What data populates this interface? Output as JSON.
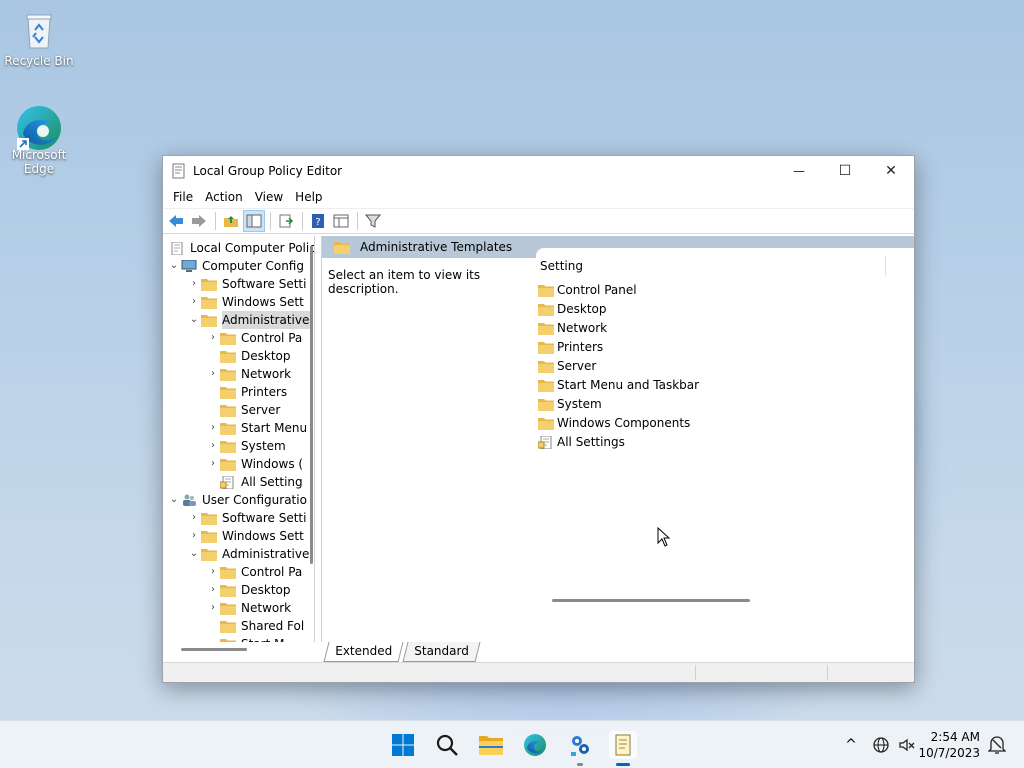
{
  "desktop": {
    "icons": [
      {
        "label": "Recycle Bin"
      },
      {
        "label_line1": "Microsoft",
        "label_line2": "Edge"
      }
    ]
  },
  "window": {
    "title": "Local Group Policy Editor",
    "controls": {
      "minimize": "—",
      "maximize": "☐",
      "close": "✕"
    },
    "menu": [
      "File",
      "Action",
      "View",
      "Help"
    ],
    "tree": [
      {
        "label": "Local Computer Polic",
        "level": 0,
        "chevron": "",
        "icon": "computer-policy-icon"
      },
      {
        "label": "Computer Config",
        "level": 1,
        "chevron": "⌄",
        "icon": "computer-icon"
      },
      {
        "label": "Software Setti",
        "level": 2,
        "chevron": "›",
        "icon": "folder-icon"
      },
      {
        "label": "Windows Sett",
        "level": 2,
        "chevron": "›",
        "icon": "folder-icon"
      },
      {
        "label": "Administrative",
        "level": 2,
        "chevron": "⌄",
        "icon": "folder-icon",
        "selected": true
      },
      {
        "label": "Control Pa",
        "level": 3,
        "chevron": "›",
        "icon": "folder-icon"
      },
      {
        "label": "Desktop",
        "level": 3,
        "chevron": "",
        "icon": "folder-icon"
      },
      {
        "label": "Network",
        "level": 3,
        "chevron": "›",
        "icon": "folder-icon"
      },
      {
        "label": "Printers",
        "level": 3,
        "chevron": "",
        "icon": "folder-icon"
      },
      {
        "label": "Server",
        "level": 3,
        "chevron": "",
        "icon": "folder-icon"
      },
      {
        "label": "Start Menu",
        "level": 3,
        "chevron": "›",
        "icon": "folder-icon"
      },
      {
        "label": "System",
        "level": 3,
        "chevron": "›",
        "icon": "folder-icon"
      },
      {
        "label": "Windows (",
        "level": 3,
        "chevron": "›",
        "icon": "folder-icon"
      },
      {
        "label": "All Setting",
        "level": 3,
        "chevron": "",
        "icon": "settings-page-icon"
      },
      {
        "label": "User Configuratio",
        "level": 1,
        "chevron": "⌄",
        "icon": "users-icon"
      },
      {
        "label": "Software Setti",
        "level": 2,
        "chevron": "›",
        "icon": "folder-icon"
      },
      {
        "label": "Windows Sett",
        "level": 2,
        "chevron": "›",
        "icon": "folder-icon"
      },
      {
        "label": "Administrative",
        "level": 2,
        "chevron": "⌄",
        "icon": "folder-icon"
      },
      {
        "label": "Control Pa",
        "level": 3,
        "chevron": "›",
        "icon": "folder-icon"
      },
      {
        "label": "Desktop",
        "level": 3,
        "chevron": "›",
        "icon": "folder-icon"
      },
      {
        "label": "Network",
        "level": 3,
        "chevron": "›",
        "icon": "folder-icon"
      },
      {
        "label": "Shared Fol",
        "level": 3,
        "chevron": "",
        "icon": "folder-icon"
      },
      {
        "label": "Start M",
        "level": 3,
        "chevron": "",
        "icon": "folder-icon"
      }
    ],
    "right": {
      "header": "Administrative Templates",
      "description": "Select an item to view its description.",
      "column": "Setting",
      "items": [
        {
          "label": "Control Panel",
          "icon": "folder-icon"
        },
        {
          "label": "Desktop",
          "icon": "folder-icon"
        },
        {
          "label": "Network",
          "icon": "folder-icon"
        },
        {
          "label": "Printers",
          "icon": "folder-icon"
        },
        {
          "label": "Server",
          "icon": "folder-icon"
        },
        {
          "label": "Start Menu and Taskbar",
          "icon": "folder-icon"
        },
        {
          "label": "System",
          "icon": "folder-icon"
        },
        {
          "label": "Windows Components",
          "icon": "folder-icon"
        },
        {
          "label": "All Settings",
          "icon": "settings-page-icon"
        }
      ]
    },
    "tabs": [
      {
        "label": "Extended",
        "active": true
      },
      {
        "label": "Standard",
        "active": false
      }
    ]
  },
  "taskbar": {
    "time": "2:54 AM",
    "date": "10/7/2023",
    "overflow": "^"
  },
  "colors": {
    "folder": "#e8b84a",
    "accent": "#0067c0",
    "header": "#b8c8d8"
  }
}
